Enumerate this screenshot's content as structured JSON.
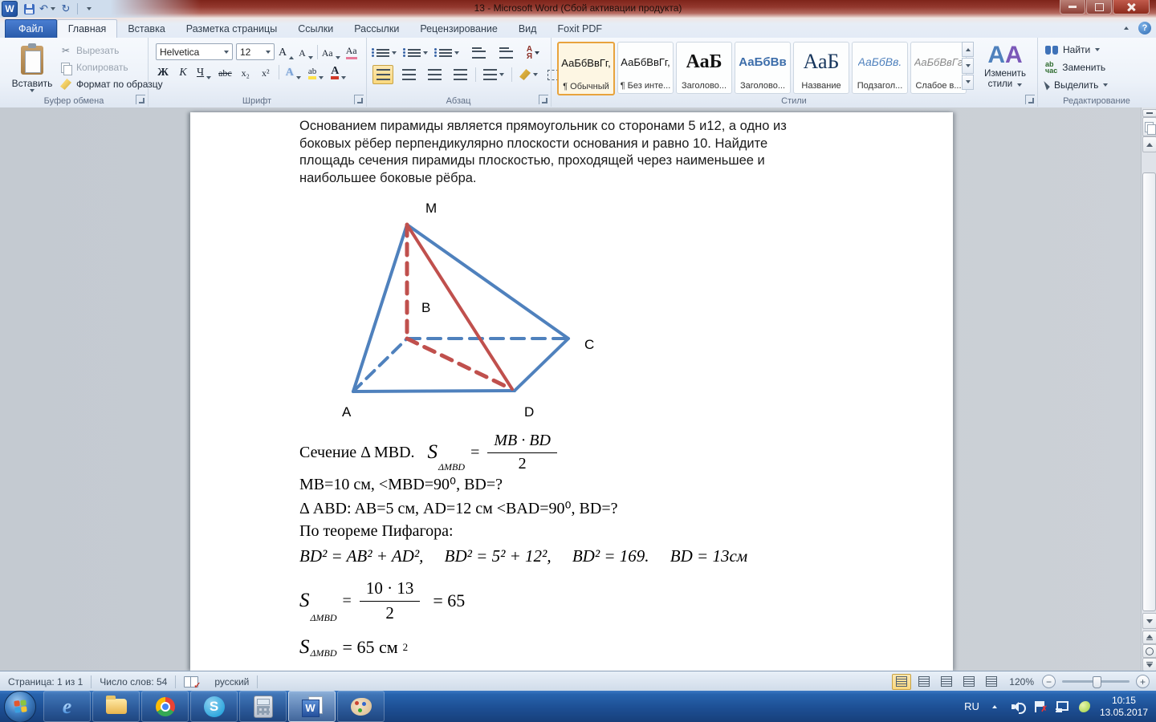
{
  "titlebar": {
    "title": "13  -  Microsoft Word (Сбой активации продукта)"
  },
  "ribbon": {
    "tabs": [
      "Файл",
      "Главная",
      "Вставка",
      "Разметка страницы",
      "Ссылки",
      "Рассылки",
      "Рецензирование",
      "Вид",
      "Foxit PDF"
    ],
    "clipboard": {
      "label": "Буфер обмена",
      "paste": "Вставить",
      "cut": "Вырезать",
      "copy": "Копировать",
      "format_painter": "Формат по образцу"
    },
    "font": {
      "label": "Шрифт",
      "family": "Helvetica",
      "size": "12",
      "bold": "Ж",
      "italic": "К",
      "underline": "Ч",
      "strike": "abc",
      "sub": "x₂",
      "sup": "x²",
      "case": "Аа",
      "grow": "А",
      "shrink": "А",
      "effects": "А",
      "highlight": "ab",
      "color": "А",
      "clear": "Аа"
    },
    "paragraph": {
      "label": "Абзац",
      "sort_top": "А",
      "sort_bottom": "Я",
      "pilcrow": "¶"
    },
    "styles": {
      "label": "Стили",
      "change": "Изменить стили",
      "change_icon": "АА",
      "items": [
        {
          "preview": "АаБбВвГг,",
          "name": "¶ Обычный"
        },
        {
          "preview": "АаБбВвГг,",
          "name": "¶ Без инте..."
        },
        {
          "preview": "АаБ",
          "name": "Заголово..."
        },
        {
          "preview": "АаБбВв",
          "name": "Заголово..."
        },
        {
          "preview": "АаБ",
          "name": "Название"
        },
        {
          "preview": "АаБбВв.",
          "name": "Подзагол..."
        },
        {
          "preview": "АаБбВвГг",
          "name": "Слабое в..."
        }
      ]
    },
    "editing": {
      "label": "Редактирование",
      "find": "Найти",
      "replace": "Заменить",
      "select": "Выделить",
      "replace_icon": "ab\nчас"
    }
  },
  "document": {
    "paragraph_lines": [
      "Основанием пирамиды является прямоугольник со сторонами 5 и12, а одно из",
      "боковых рёбер перпендикулярно плоскости основания и равно 10. Найдите",
      "площадь сечения пирамиды плоскостью, проходящей через наименьшее и",
      "наибольшее боковые рёбра."
    ],
    "diagram": {
      "blue": "#4f81bd",
      "red": "#c0504d",
      "labels": {
        "M": "M",
        "B": "B",
        "C": "C",
        "A": "A",
        "D": "D"
      }
    },
    "math": {
      "line1_prefix": "Сечение Δ MBD.",
      "f1": {
        "s": "S",
        "sub": "ΔMBD",
        "eq": "=",
        "num": "MB · BD",
        "den": "2"
      },
      "line2": "MB=10 см, <MBD=90⁰, BD=?",
      "line3": "Δ ABD: AB=5 см, AD=12 см <BAD=90⁰, BD=?",
      "line4": "По теореме Пифагора:",
      "line5": "BD² = AB² + AD²,     BD² = 5² + 12²,     BD² = 169.     BD = 13см",
      "f2": {
        "s": "S",
        "sub": "ΔMBD",
        "eq": "=",
        "num": "10 · 13",
        "den": "2",
        "result": "= 65"
      },
      "f3": {
        "s": "S",
        "sub": "ΔMBD",
        "eq": "= 65 см",
        "sup": "2"
      }
    }
  },
  "statusbar": {
    "page": "Страница: 1 из 1",
    "words": "Число слов: 54",
    "language": "русский",
    "zoom": "120%"
  },
  "taskbar": {
    "lang": "RU",
    "time": "10:15",
    "date": "13.05.2017"
  },
  "icons": {
    "ie": "e",
    "skype": "S",
    "word": "W",
    "word_logo": "W",
    "undo": "↶",
    "redo": "↻",
    "scissors": "✂",
    "help": "?",
    "minus": "−",
    "plus": "+"
  }
}
